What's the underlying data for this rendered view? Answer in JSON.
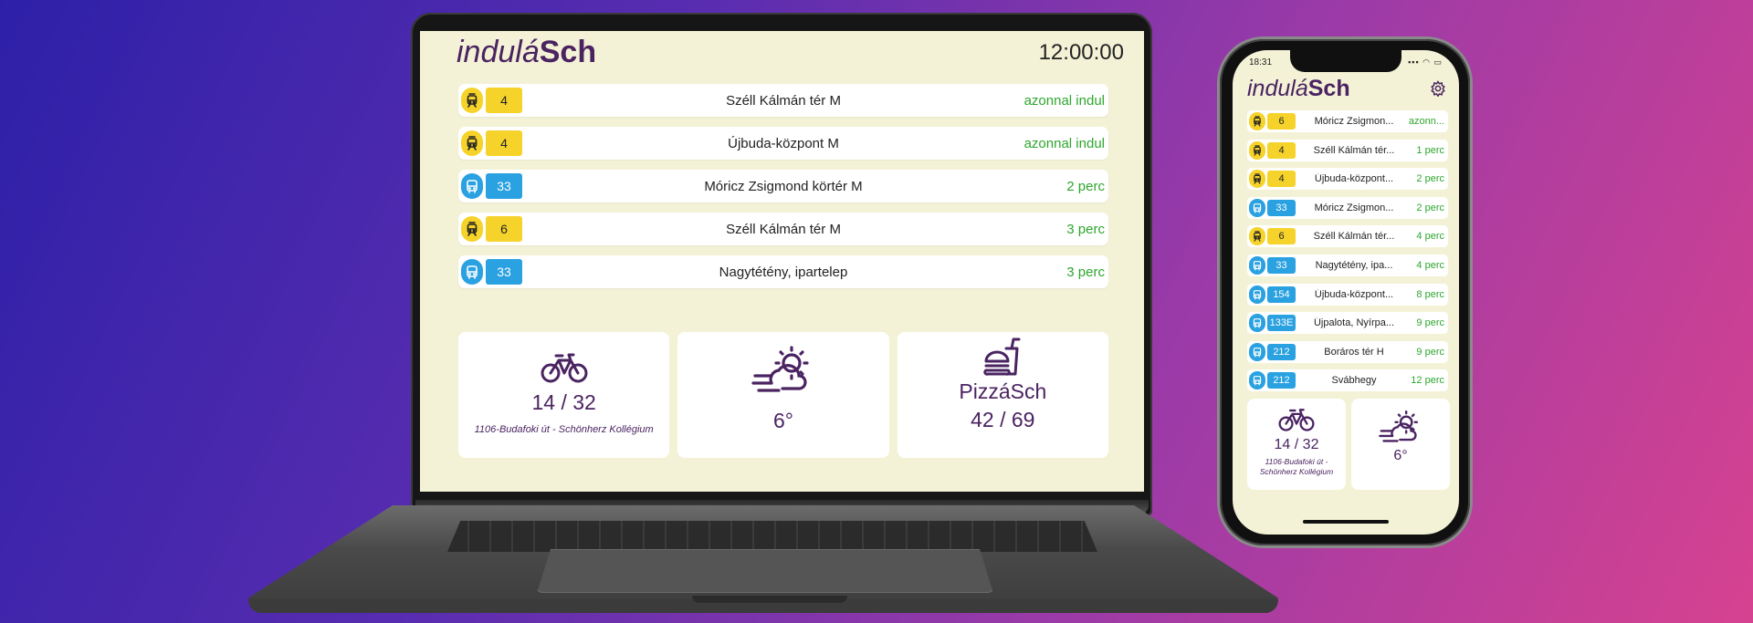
{
  "laptop": {
    "logo_light": "indulá",
    "logo_bold": "Sch",
    "clock": "12:00:00",
    "departures": [
      {
        "type": "tram",
        "line": "4",
        "destination": "Széll Kálmán tér M",
        "eta": "azonnal indul"
      },
      {
        "type": "tram",
        "line": "4",
        "destination": "Újbuda-központ M",
        "eta": "azonnal indul"
      },
      {
        "type": "bus",
        "line": "33",
        "destination": "Móricz Zsigmond körtér M",
        "eta": "2 perc"
      },
      {
        "type": "tram",
        "line": "6",
        "destination": "Széll Kálmán tér M",
        "eta": "3 perc"
      },
      {
        "type": "bus",
        "line": "33",
        "destination": "Nagytétény, ipartelep",
        "eta": "3 perc"
      }
    ],
    "bike": {
      "count": "14 / 32",
      "station": "1106-Budafoki út - Schönherz Kollégium"
    },
    "weather": {
      "temp": "6°"
    },
    "pizza": {
      "name": "PizzáSch",
      "count": "42 / 69"
    }
  },
  "phone": {
    "status_time": "18:31",
    "status_icons": "▪▪▪ ◠ ▭",
    "logo_light": "indulá",
    "logo_bold": "Sch",
    "departures": [
      {
        "type": "tram",
        "line": "6",
        "destination": "Móricz Zsigmon...",
        "eta": "azonn..."
      },
      {
        "type": "tram",
        "line": "4",
        "destination": "Széll Kálmán tér...",
        "eta": "1 perc"
      },
      {
        "type": "tram",
        "line": "4",
        "destination": "Újbuda-központ...",
        "eta": "2 perc"
      },
      {
        "type": "bus",
        "line": "33",
        "destination": "Móricz Zsigmon...",
        "eta": "2 perc"
      },
      {
        "type": "tram",
        "line": "6",
        "destination": "Széll Kálmán tér...",
        "eta": "4 perc"
      },
      {
        "type": "bus",
        "line": "33",
        "destination": "Nagytétény, ipa...",
        "eta": "4 perc"
      },
      {
        "type": "bus",
        "line": "154",
        "destination": "Újbuda-központ...",
        "eta": "8 perc"
      },
      {
        "type": "bus",
        "line": "133E",
        "destination": "Újpalota, Nyírpa...",
        "eta": "9 perc"
      },
      {
        "type": "bus",
        "line": "212",
        "destination": "Boráros tér H",
        "eta": "9 perc"
      },
      {
        "type": "bus",
        "line": "212",
        "destination": "Svábhegy",
        "eta": "12 perc"
      }
    ],
    "bike": {
      "count": "14 / 32",
      "station": "1106-Budafoki út - Schönherz Kollégium"
    },
    "weather": {
      "temp": "6°"
    }
  },
  "colors": {
    "brand": "#4a2361",
    "tram": "#f6d32a",
    "bus": "#2aa1e0",
    "eta_green": "#2ea62e",
    "screen_bg": "#f4f2d6"
  },
  "icons": {
    "tram": "tram-icon",
    "bus": "bus-icon",
    "bike": "bicycle-icon",
    "weather": "windy-partly-cloudy-icon",
    "food": "burger-drink-icon",
    "settings": "gear-icon"
  }
}
